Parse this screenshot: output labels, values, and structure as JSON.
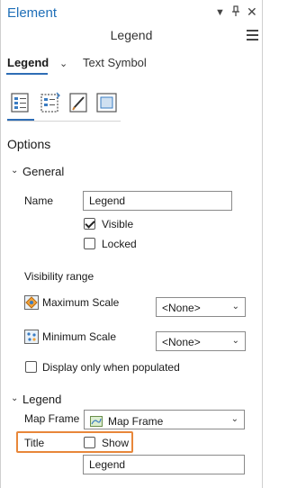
{
  "panel": {
    "title": "Element",
    "heading": "Legend"
  },
  "titlebar_icons": [
    "chevron-down-icon",
    "pin-icon",
    "close-icon"
  ],
  "tabs": {
    "active": "Legend",
    "other": "Text Symbol"
  },
  "icon_tabs": [
    "legend-options-icon",
    "legend-arrange-icon",
    "symbol-pen-icon",
    "display-frame-icon"
  ],
  "options": {
    "heading": "Options",
    "general": {
      "heading": "General",
      "name_label": "Name",
      "name_value": "Legend",
      "visible_label": "Visible",
      "visible_checked": true,
      "locked_label": "Locked",
      "locked_checked": false,
      "visibility_range_label": "Visibility range",
      "max_scale_label": "Maximum Scale",
      "max_scale_value": "<None>",
      "min_scale_label": "Minimum Scale",
      "min_scale_value": "<None>",
      "display_populated_label": "Display only when populated",
      "display_populated_checked": false
    },
    "legend": {
      "heading": "Legend",
      "map_frame_label": "Map Frame",
      "map_frame_value": "Map Frame",
      "title_label": "Title",
      "show_label": "Show",
      "show_checked": false,
      "title_value": "Legend"
    }
  },
  "colors": {
    "accent": "#2e6db5",
    "highlight": "#e8873a"
  }
}
